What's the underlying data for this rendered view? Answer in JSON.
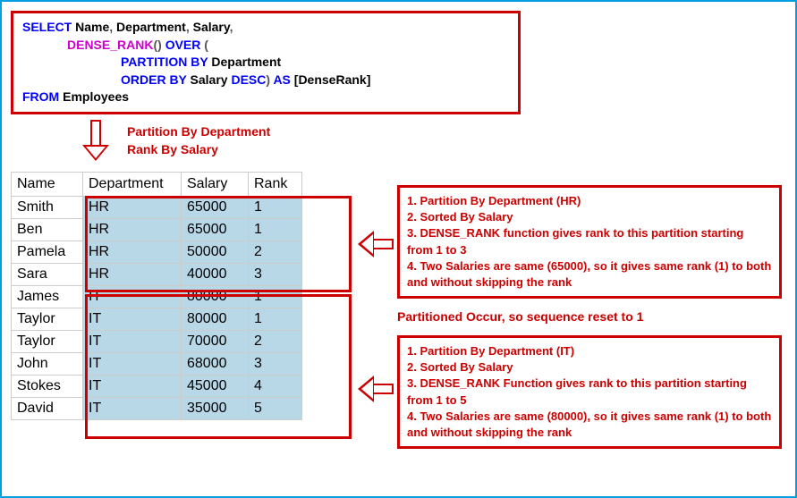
{
  "sql": {
    "select": "SELECT",
    "name": "Name",
    "dept": "Department",
    "salary": "Salary",
    "dense_rank": "DENSE_RANK",
    "paren_open": "()",
    "over": "OVER",
    "open": "(",
    "partition_by": "PARTITION BY",
    "order_by": "ORDER BY",
    "desc": "DESC",
    "close": ")",
    "as": "AS",
    "alias": "[DenseRank]",
    "from": "FROM",
    "table": "Employees"
  },
  "arrowdown_label1": "Partition By Department",
  "arrowdown_label2": "Rank By Salary",
  "table": {
    "headers": {
      "name": "Name",
      "dept": "Department",
      "salary": "Salary",
      "rank": "Rank"
    },
    "rows": [
      {
        "name": "Smith",
        "dept": "HR",
        "salary": "65000",
        "rank": "1"
      },
      {
        "name": "Ben",
        "dept": "HR",
        "salary": "65000",
        "rank": "1"
      },
      {
        "name": "Pamela",
        "dept": "HR",
        "salary": "50000",
        "rank": "2"
      },
      {
        "name": "Sara",
        "dept": "HR",
        "salary": "40000",
        "rank": "3"
      },
      {
        "name": "James",
        "dept": "IT",
        "salary": "80000",
        "rank": "1"
      },
      {
        "name": "Taylor",
        "dept": "IT",
        "salary": "80000",
        "rank": "1"
      },
      {
        "name": "Taylor",
        "dept": "IT",
        "salary": "70000",
        "rank": "2"
      },
      {
        "name": "John",
        "dept": "IT",
        "salary": "68000",
        "rank": "3"
      },
      {
        "name": "Stokes",
        "dept": "IT",
        "salary": "45000",
        "rank": "4"
      },
      {
        "name": "David",
        "dept": "IT",
        "salary": "35000",
        "rank": "5"
      }
    ]
  },
  "box1": {
    "l1": "1. Partition By Department (HR)",
    "l2": "2. Sorted By Salary",
    "l3": "3. DENSE_RANK function gives rank to this partition starting from 1 to 3",
    "l4": "4. Two Salaries are same (65000), so it gives same rank (1) to both and without skipping the rank"
  },
  "mid_text": "Partitioned Occur, so sequence reset to 1",
  "box2": {
    "l1": "1. Partition By Department (IT)",
    "l2": "2. Sorted By Salary",
    "l3": "3. DENSE_RANK Function gives rank to this partition starting from 1 to 5",
    "l4": "4. Two Salaries are same (80000), so it gives same rank (1) to both and without skipping the rank"
  }
}
